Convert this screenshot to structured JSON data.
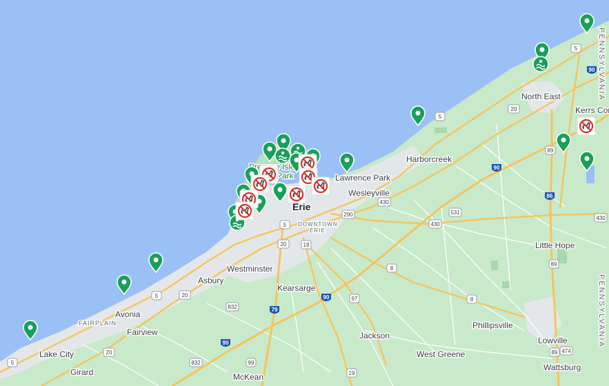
{
  "map": {
    "colors": {
      "water": "#9bc0f5",
      "land": "#c9e9cb",
      "urban": "#e4e7ea",
      "highway": "#f7c45c",
      "pin": "#18a05a",
      "no_dogs": "#d93025"
    },
    "places": {
      "erie": "Erie",
      "downtown_line1": "DOWNTOWN",
      "downtown_line2": "ERIE",
      "presque_isle_line1": "Presque Isle",
      "presque_isle_line2": "Park",
      "lawrence_park": "Lawrence Park",
      "wesleyville": "Wesleyville",
      "harborcreek": "Harborcreek",
      "north_east": "North East",
      "kerrs_corners": "Kerrs Cor",
      "little_hope": "Little Hope",
      "westminster": "Westminster",
      "asbury": "Asbury",
      "kearsarge": "Kearsarge",
      "avonia": "Avonia",
      "fairview": "Fairview",
      "fairplain": "FAIRPLAIN",
      "lake_city": "Lake City",
      "girard": "Girard",
      "mckean": "McKean",
      "jackson": "Jackson",
      "west_greene": "West Greene",
      "phillipsville": "Phillipsville",
      "lowville": "Lowville",
      "wattsburg": "Wattsburg",
      "pennsylvania_top": "PENNSYLVANIA",
      "pennsylvania_bottom": "PENNSYLVANIA"
    },
    "routes": {
      "r5_ne": "5",
      "i90_ne": "90",
      "r20_ne": "20",
      "r5_harbor": "5",
      "i90_harbor": "90",
      "r89_a": "89",
      "i86": "86",
      "r430_east": "430",
      "r430_wes": "430",
      "r290": "290",
      "r531": "531",
      "r430_mid": "430",
      "r5_erie": "5",
      "r20_erie": "20",
      "r19_erie": "19",
      "r8_a": "8",
      "r89_b": "89",
      "r8_b": "8",
      "r832_a": "832",
      "i79": "79",
      "i90_mid": "90",
      "r97": "97",
      "r5_west": "5",
      "r20_west": "20",
      "i90_west": "90",
      "r20_fv": "20",
      "r5_far": "5",
      "r832_b": "832",
      "r99": "99",
      "r19_s": "19",
      "r474": "474",
      "r89_c": "89"
    },
    "markers": [
      {
        "kind": "pin"
      },
      {
        "kind": "pin"
      },
      {
        "kind": "pin"
      },
      {
        "kind": "pin"
      },
      {
        "kind": "pin"
      },
      {
        "kind": "pin"
      },
      {
        "kind": "pin"
      },
      {
        "kind": "pin"
      },
      {
        "kind": "pin"
      },
      {
        "kind": "pin"
      },
      {
        "kind": "pin"
      },
      {
        "kind": "pin"
      },
      {
        "kind": "pin"
      },
      {
        "kind": "pin"
      },
      {
        "kind": "pin"
      },
      {
        "kind": "pin"
      },
      {
        "kind": "pin"
      },
      {
        "kind": "pin"
      },
      {
        "kind": "pin"
      },
      {
        "kind": "pin"
      },
      {
        "kind": "pin"
      },
      {
        "kind": "pin"
      },
      {
        "kind": "no-dogs"
      },
      {
        "kind": "no-dogs"
      },
      {
        "kind": "no-dogs"
      },
      {
        "kind": "no-dogs"
      },
      {
        "kind": "no-dogs"
      },
      {
        "kind": "no-dogs"
      },
      {
        "kind": "no-dogs"
      },
      {
        "kind": "no-dogs"
      },
      {
        "kind": "no-dogs"
      }
    ]
  }
}
